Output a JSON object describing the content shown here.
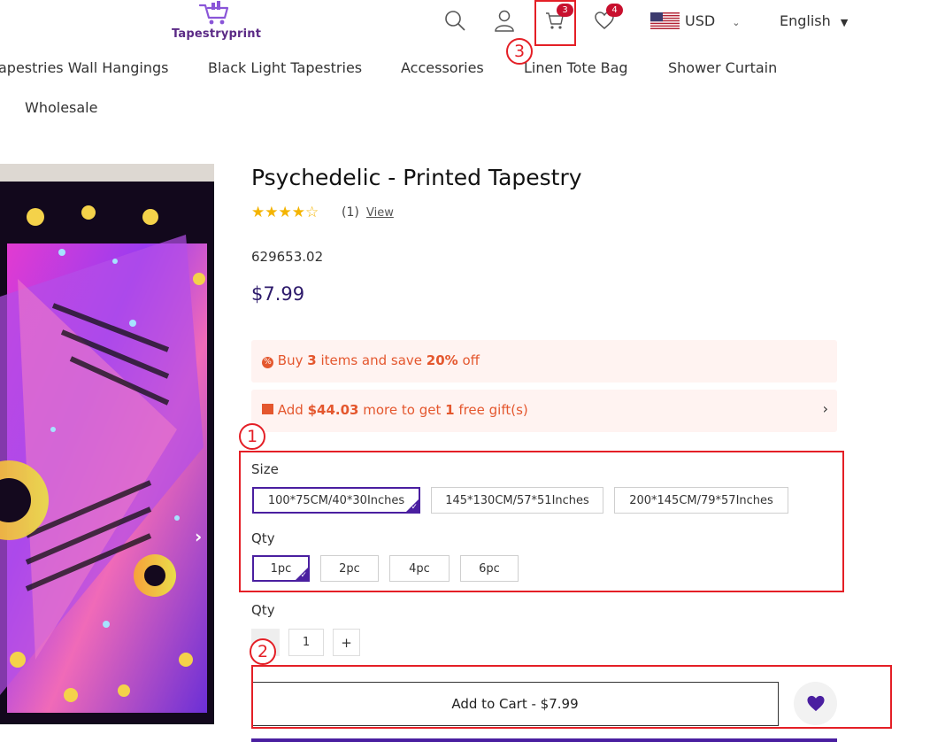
{
  "header": {
    "logo_text": "Tapestryprint",
    "cart_badge": "3",
    "wishlist_badge": "4",
    "currency": "USD",
    "language": "English"
  },
  "nav": {
    "items": [
      "apestries Wall Hangings",
      "Black Light Tapestries",
      "Accessories",
      "Linen Tote Bag",
      "Shower Curtain",
      "Wholesale"
    ]
  },
  "product": {
    "title": "Psychedelic - Printed Tapestry",
    "rating_count": "(1)",
    "rating_view": "View",
    "rating_value": 4,
    "sku": "629653.02",
    "price": "$7.99",
    "promo1": {
      "pre": "Buy ",
      "qty": "3",
      "mid": " items and save ",
      "pct": "20%",
      "post": " off"
    },
    "promo2": {
      "pre": "Add ",
      "amount": "$44.03",
      "mid": " more to get ",
      "count": "1",
      "post": " free gift(s)"
    },
    "size_label": "Size",
    "sizes": [
      "100*75CM/40*30Inches",
      "145*130CM/57*51Inches",
      "200*145CM/79*57Inches"
    ],
    "selected_size": "100*75CM/40*30Inches",
    "pack_label": "Qty",
    "packs": [
      "1pc",
      "2pc",
      "4pc",
      "6pc"
    ],
    "selected_pack": "1pc",
    "qty_label": "Qty",
    "qty_value": "1",
    "qty_plus": "+",
    "add_to_cart": "Add to Cart - $7.99"
  },
  "annotations": {
    "n1": "1",
    "n2": "2",
    "n3": "3"
  },
  "colors": {
    "accent": "#4a1fa0",
    "promo_text": "#e4572e",
    "annotation": "#e41f26",
    "badge": "#c8102e"
  }
}
